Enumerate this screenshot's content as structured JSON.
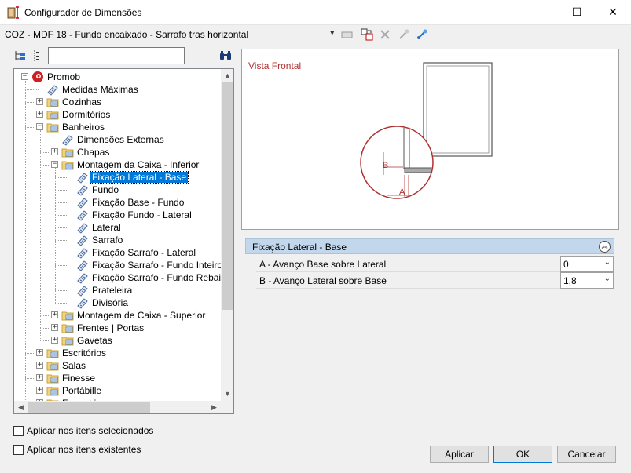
{
  "window": {
    "title": "Configurador de Dimensões",
    "min_glyph": "—",
    "max_glyph": "☐",
    "close_glyph": "✕"
  },
  "toolbar": {
    "path": "COZ - MDF 18 - Fundo encaixado - Sarrafo tras horizontal",
    "dropdown_glyph": "▾",
    "icons": [
      "dropdown-arrow-icon",
      "rename-icon",
      "move-icon",
      "delete-icon",
      "link-icon",
      "unlink-icon"
    ]
  },
  "tree_toolbar": {
    "icons": [
      "expand-tree-icon",
      "collapse-tree-icon",
      "binoculars-icon"
    ],
    "search_value": "",
    "search_placeholder": ""
  },
  "tree": {
    "items": [
      {
        "label": "Promob",
        "level": 0,
        "icon": "promob-logo-icon",
        "expander": "minus"
      },
      {
        "label": "Medidas Máximas",
        "level": 1,
        "icon": "ruler-tag-icon",
        "expander": ""
      },
      {
        "label": "Cozinhas",
        "level": 1,
        "icon": "folder-icon",
        "expander": "plus"
      },
      {
        "label": "Dormitórios",
        "level": 1,
        "icon": "folder-icon",
        "expander": "plus"
      },
      {
        "label": "Banheiros",
        "level": 1,
        "icon": "folder-icon",
        "expander": "minus"
      },
      {
        "label": "Dimensões Externas",
        "level": 2,
        "icon": "ruler-tag-icon",
        "expander": ""
      },
      {
        "label": "Chapas",
        "level": 2,
        "icon": "folder-icon",
        "expander": "plus"
      },
      {
        "label": "Montagem da Caixa - Inferior",
        "level": 2,
        "icon": "folder-icon",
        "expander": "minus"
      },
      {
        "label": "Fixação Lateral - Base",
        "level": 3,
        "icon": "ruler-tag-icon",
        "expander": "",
        "selected": true
      },
      {
        "label": "Fundo",
        "level": 3,
        "icon": "ruler-tag-icon",
        "expander": ""
      },
      {
        "label": "Fixação Base - Fundo",
        "level": 3,
        "icon": "ruler-tag-icon",
        "expander": ""
      },
      {
        "label": "Fixação Fundo - Lateral",
        "level": 3,
        "icon": "ruler-tag-icon",
        "expander": ""
      },
      {
        "label": "Lateral",
        "level": 3,
        "icon": "ruler-tag-icon",
        "expander": ""
      },
      {
        "label": "Sarrafo",
        "level": 3,
        "icon": "ruler-tag-icon",
        "expander": ""
      },
      {
        "label": "Fixação Sarrafo - Lateral",
        "level": 3,
        "icon": "ruler-tag-icon",
        "expander": ""
      },
      {
        "label": "Fixação Sarrafo - Fundo Inteiro",
        "level": 3,
        "icon": "ruler-tag-icon",
        "expander": ""
      },
      {
        "label": "Fixação Sarrafo - Fundo Rebaixado",
        "level": 3,
        "icon": "ruler-tag-icon",
        "expander": ""
      },
      {
        "label": "Prateleira",
        "level": 3,
        "icon": "ruler-tag-icon",
        "expander": ""
      },
      {
        "label": "Divisória",
        "level": 3,
        "icon": "ruler-tag-icon",
        "expander": ""
      },
      {
        "label": "Montagem de Caixa - Superior",
        "level": 2,
        "icon": "folder-icon",
        "expander": "plus"
      },
      {
        "label": "Frentes | Portas",
        "level": 2,
        "icon": "folder-icon",
        "expander": "plus"
      },
      {
        "label": "Gavetas",
        "level": 2,
        "icon": "folder-icon",
        "expander": "plus"
      },
      {
        "label": "Escritórios",
        "level": 1,
        "icon": "folder-icon",
        "expander": "plus"
      },
      {
        "label": "Salas",
        "level": 1,
        "icon": "folder-icon",
        "expander": "plus"
      },
      {
        "label": "Finesse",
        "level": 1,
        "icon": "folder-icon",
        "expander": "plus"
      },
      {
        "label": "Portábille",
        "level": 1,
        "icon": "folder-icon",
        "expander": "plus"
      },
      {
        "label": "Força Livre",
        "level": 1,
        "icon": "folder-icon",
        "expander": "plus"
      }
    ]
  },
  "preview": {
    "title": "Vista Frontal",
    "label_a": "A",
    "label_b": "B",
    "accent": "#b03030"
  },
  "properties": {
    "header": "Fixação Lateral - Base",
    "collapse_glyph": "︽",
    "rows": [
      {
        "label": "A - Avanço Base sobre Lateral",
        "value": "0"
      },
      {
        "label": "B - Avanço Lateral sobre Base",
        "value": "1,8"
      }
    ],
    "drop_glyph": "⌄"
  },
  "options": {
    "apply_selected": "Aplicar nos itens selecionados",
    "apply_existing": "Aplicar nos itens existentes"
  },
  "buttons": {
    "apply": "Aplicar",
    "ok": "OK",
    "cancel": "Cancelar"
  },
  "scroll": {
    "up": "▲",
    "down": "▼",
    "left": "◀",
    "right": "▶"
  }
}
